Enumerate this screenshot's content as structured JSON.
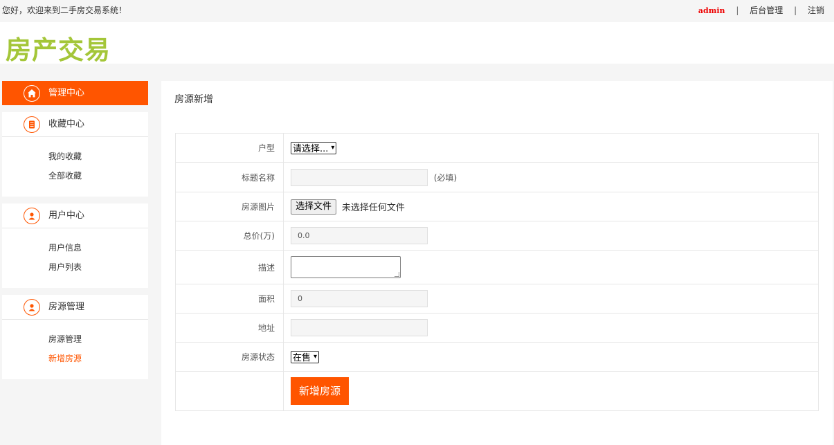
{
  "topbar": {
    "welcome": "您好，欢迎来到二手房交易系统！",
    "user": "admin",
    "separator": "|",
    "admin_link": "后台管理",
    "logout_link": "注销"
  },
  "header": {
    "logo": "房产交易"
  },
  "sidebar": {
    "manage": {
      "label": "管理中心",
      "icon": "home-icon"
    },
    "favorites": {
      "label": "收藏中心",
      "icon": "document-icon",
      "items": [
        "我的收藏",
        "全部收藏"
      ]
    },
    "users": {
      "label": "用户中心",
      "icon": "user-icon",
      "items": [
        "用户信息",
        "用户列表"
      ]
    },
    "houses": {
      "label": "房源管理",
      "icon": "user-icon",
      "items": [
        "房源管理",
        "新增房源"
      ]
    }
  },
  "form": {
    "title": "房源新增",
    "rows": {
      "type": {
        "label": "户型",
        "selected": "请选择..."
      },
      "name": {
        "label": "标题名称",
        "value": "",
        "hint": "(必填)"
      },
      "image": {
        "label": "房源图片",
        "button": "选择文件",
        "status": "未选择任何文件"
      },
      "price": {
        "label": "总价(万)",
        "value": "0.0"
      },
      "desc": {
        "label": "描述",
        "value": ""
      },
      "size": {
        "label": "面积",
        "value": "0"
      },
      "address": {
        "label": "地址",
        "value": ""
      },
      "status": {
        "label": "房源状态",
        "selected": "在售"
      }
    },
    "submit": "新增房源"
  },
  "colors": {
    "accent": "#ff5500",
    "logo": "#a4c639",
    "background": "#f5f5f5"
  }
}
